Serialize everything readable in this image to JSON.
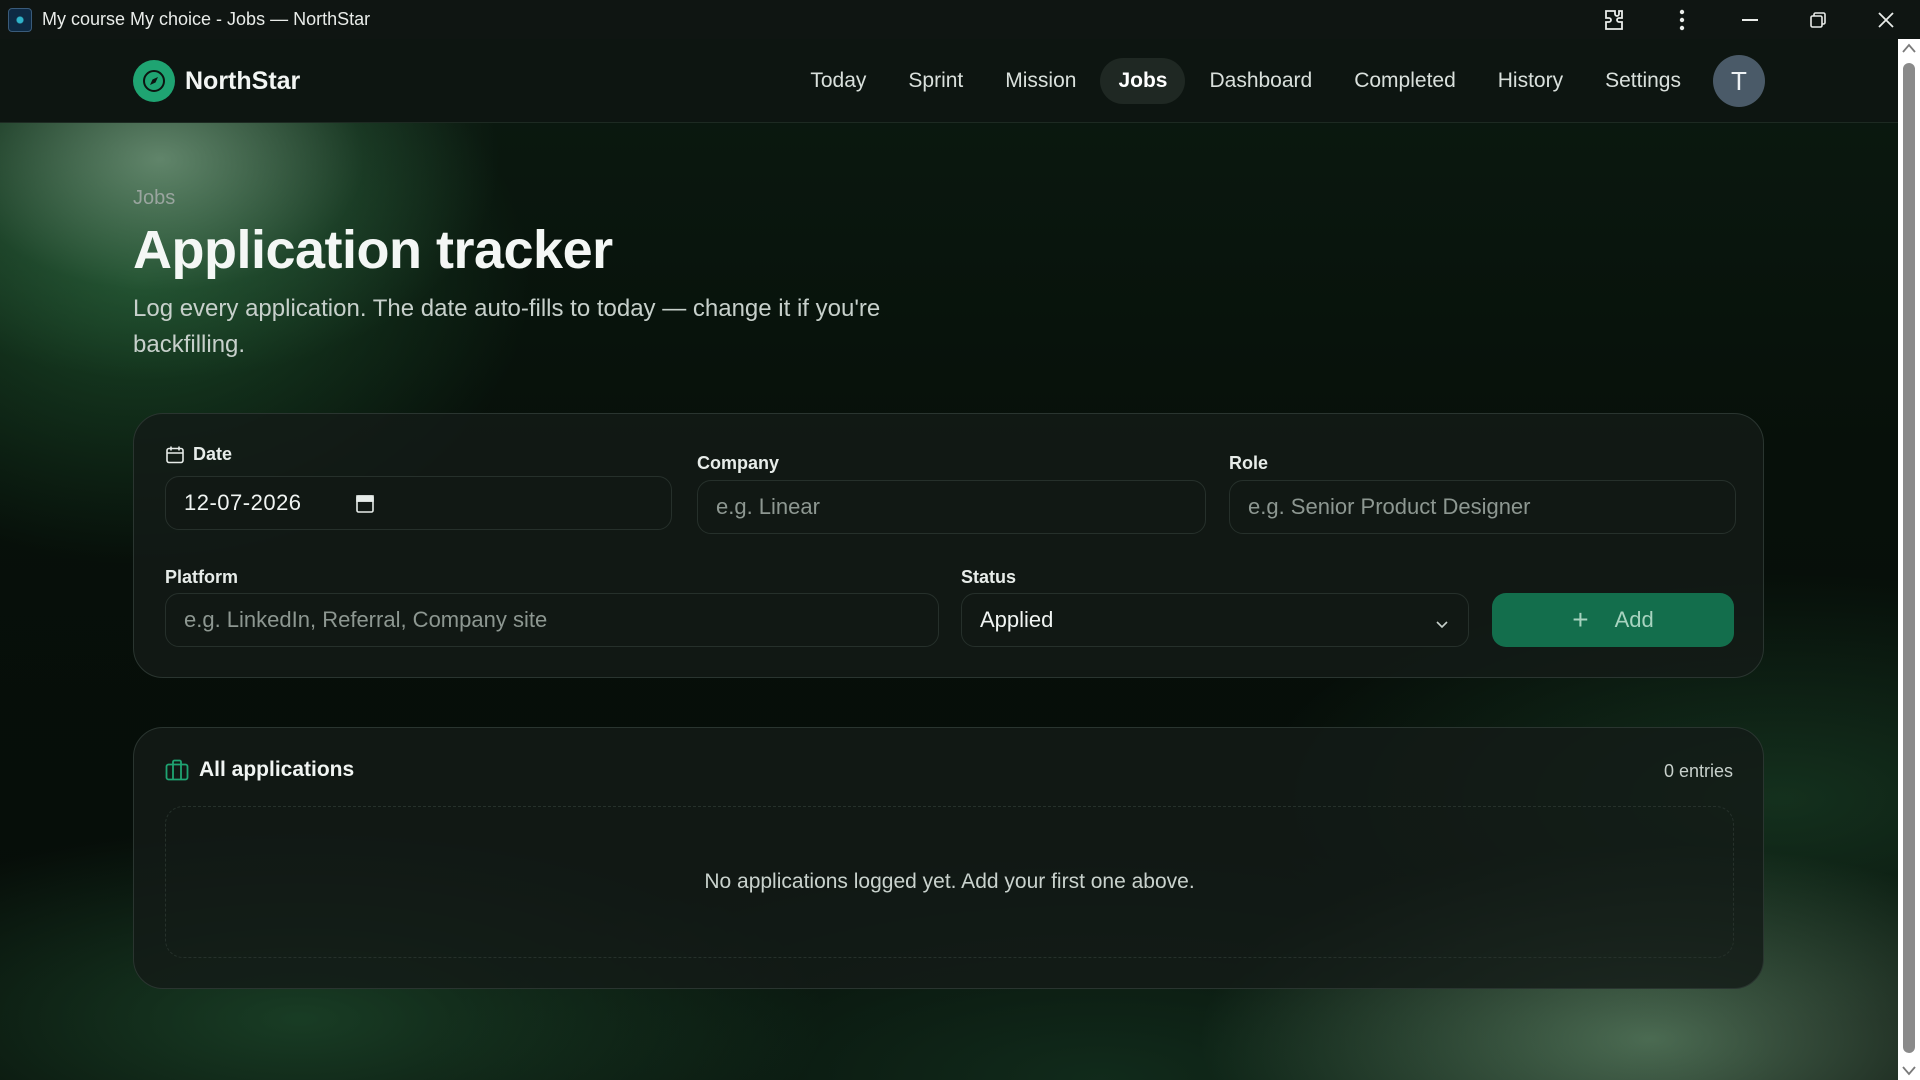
{
  "window": {
    "title": "My course My choice - Jobs — NorthStar"
  },
  "brand": {
    "name": "NorthStar"
  },
  "nav": {
    "items": [
      {
        "label": "Today",
        "active": false
      },
      {
        "label": "Sprint",
        "active": false
      },
      {
        "label": "Mission",
        "active": false
      },
      {
        "label": "Jobs",
        "active": true
      },
      {
        "label": "Dashboard",
        "active": false
      },
      {
        "label": "Completed",
        "active": false
      },
      {
        "label": "History",
        "active": false
      },
      {
        "label": "Settings",
        "active": false
      }
    ],
    "avatar_initial": "T"
  },
  "page": {
    "eyebrow": "Jobs",
    "title": "Application tracker",
    "subtitle": "Log every application. The date auto-fills to today — change it if you're backfilling."
  },
  "form": {
    "date": {
      "label": "Date",
      "value": "12-07-2026"
    },
    "company": {
      "label": "Company",
      "placeholder": "e.g. Linear"
    },
    "role": {
      "label": "Role",
      "placeholder": "e.g. Senior Product Designer"
    },
    "platform": {
      "label": "Platform",
      "placeholder": "e.g. LinkedIn, Referral, Company site"
    },
    "status": {
      "label": "Status",
      "value": "Applied"
    },
    "add_label": "Add"
  },
  "list": {
    "title": "All applications",
    "count": "0 entries",
    "empty_message": "No applications logged yet. Add your first one above."
  },
  "colors": {
    "accent": "#1fa472",
    "button": "#136e4c",
    "background": "#050a07"
  },
  "icons": {
    "calendar": "calendar-icon",
    "briefcase": "briefcase-icon",
    "compass": "compass-icon"
  }
}
